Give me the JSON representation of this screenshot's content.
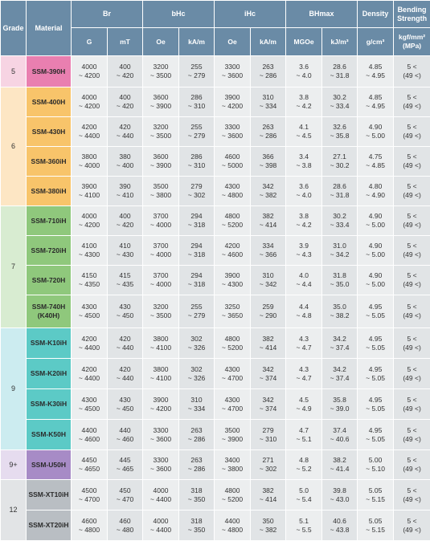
{
  "colors": {
    "header_bg": "#6a8ba6",
    "grade_bg": {
      "5": "#f7d4e3",
      "6": "#fde6c4",
      "7": "#d8ecd1",
      "9": "#ccecf0",
      "9+": "#e6dcef",
      "12": "#e2e4e6"
    },
    "material_bg": {
      "5": "#e97fb0",
      "6": "#f8c46a",
      "7": "#8fc87c",
      "9": "#5ccac6",
      "9+": "#a78bc6",
      "12": "#b9bec3"
    }
  },
  "header": {
    "grade": "Grade",
    "material": "Material",
    "br": "Br",
    "bhc": "bHc",
    "ihc": "iHc",
    "bhmax": "BHmax",
    "density": "Density",
    "bending": "Bending Strength",
    "units": {
      "br_g": "G",
      "br_mt": "mT",
      "bhc_oe": "Oe",
      "bhc_ka": "kA/m",
      "ihc_oe": "Oe",
      "ihc_ka": "kA/m",
      "bh_mgoe": "MGOe",
      "bh_kj": "kJ/m³",
      "density": "g/cm³",
      "bending": "kgf/mm²\n(MPa)"
    }
  },
  "rows": [
    {
      "grade": "5",
      "material": "SSM-390H",
      "br_g": "4000\n~ 4200",
      "br_mt": "400\n~ 420",
      "bhc_oe": "3200\n~ 3500",
      "bhc_ka": "255\n~ 279",
      "ihc_oe": "3300\n~ 3600",
      "ihc_ka": "263\n~ 286",
      "bh_mgoe": "3.6\n~ 4.0",
      "bh_kj": "28.6\n~ 31.8",
      "density": "4.85\n~ 4.95",
      "bending": "5 <\n(49 <)"
    },
    {
      "grade": "6",
      "material": "SSM-400H",
      "br_g": "4000\n~ 4200",
      "br_mt": "400\n~ 420",
      "bhc_oe": "3600\n~ 3900",
      "bhc_ka": "286\n~ 310",
      "ihc_oe": "3900\n~ 4200",
      "ihc_ka": "310\n~ 334",
      "bh_mgoe": "3.8\n~ 4.2",
      "bh_kj": "30.2\n~ 33.4",
      "density": "4.85\n~ 4.95",
      "bending": "5 <\n(49 <)"
    },
    {
      "grade": "6",
      "material": "SSM-430H",
      "br_g": "4200\n~ 4400",
      "br_mt": "420\n~ 440",
      "bhc_oe": "3200\n~ 3500",
      "bhc_ka": "255\n~ 279",
      "ihc_oe": "3300\n~ 3600",
      "ihc_ka": "263\n~ 286",
      "bh_mgoe": "4.1\n~ 4.5",
      "bh_kj": "32.6\n~ 35.8",
      "density": "4.90\n~ 5.00",
      "bending": "5 <\n(49 <)"
    },
    {
      "grade": "6",
      "material": "SSM-360iH",
      "br_g": "3800\n~ 4000",
      "br_mt": "380\n~ 400",
      "bhc_oe": "3600\n~ 3900",
      "bhc_ka": "286\n~ 310",
      "ihc_oe": "4600\n~ 5000",
      "ihc_ka": "366\n~ 398",
      "bh_mgoe": "3.4\n~ 3.8",
      "bh_kj": "27.1\n~ 30.2",
      "density": "4.75\n~ 4.85",
      "bending": "5 <\n(49 <)"
    },
    {
      "grade": "6",
      "material": "SSM-380iH",
      "br_g": "3900\n~ 4100",
      "br_mt": "390\n~ 410",
      "bhc_oe": "3500\n~ 3800",
      "bhc_ka": "279\n~ 302",
      "ihc_oe": "4300\n~ 4800",
      "ihc_ka": "342\n~ 382",
      "bh_mgoe": "3.6\n~ 4.0",
      "bh_kj": "28.6\n~ 31.8",
      "density": "4.80\n~ 4.90",
      "bending": "5 <\n(49 <)"
    },
    {
      "grade": "7",
      "material": "SSM-710iH",
      "br_g": "4000\n~ 4200",
      "br_mt": "400\n~ 420",
      "bhc_oe": "3700\n~ 4000",
      "bhc_ka": "294\n~ 318",
      "ihc_oe": "4800\n~ 5200",
      "ihc_ka": "382\n~ 414",
      "bh_mgoe": "3.8\n~ 4.2",
      "bh_kj": "30.2\n~ 33.4",
      "density": "4.90\n~ 5.00",
      "bending": "5 <\n(49 <)"
    },
    {
      "grade": "7",
      "material": "SSM-720iH",
      "br_g": "4100\n~ 4300",
      "br_mt": "410\n~ 430",
      "bhc_oe": "3700\n~ 4000",
      "bhc_ka": "294\n~ 318",
      "ihc_oe": "4200\n~ 4600",
      "ihc_ka": "334\n~ 366",
      "bh_mgoe": "3.9\n~ 4.3",
      "bh_kj": "31.0\n~ 34.2",
      "density": "4.90\n~ 5.00",
      "bending": "5 <\n(49 <)"
    },
    {
      "grade": "7",
      "material": "SSM-720H",
      "br_g": "4150\n~ 4350",
      "br_mt": "415\n~ 435",
      "bhc_oe": "3700\n~ 4000",
      "bhc_ka": "294\n~ 318",
      "ihc_oe": "3900\n~ 4300",
      "ihc_ka": "310\n~ 342",
      "bh_mgoe": "4.0\n~ 4.4",
      "bh_kj": "31.8\n~ 35.0",
      "density": "4.90\n~ 5.00",
      "bending": "5 <\n(49 <)"
    },
    {
      "grade": "7",
      "material": "SSM-740H\n(K40H)",
      "br_g": "4300\n~ 4500",
      "br_mt": "430\n~ 450",
      "bhc_oe": "3200\n~ 3500",
      "bhc_ka": "255\n~ 279",
      "ihc_oe": "3250\n~ 3650",
      "ihc_ka": "259\n~ 290",
      "bh_mgoe": "4.4\n~ 4.8",
      "bh_kj": "35.0\n~ 38.2",
      "density": "4.95\n~ 5.05",
      "bending": "5 <\n(49 <)"
    },
    {
      "grade": "9",
      "material": "SSM-K10iH",
      "br_g": "4200\n~ 4400",
      "br_mt": "420\n~ 440",
      "bhc_oe": "3800\n~ 4100",
      "bhc_ka": "302\n~ 326",
      "ihc_oe": "4800\n~ 5200",
      "ihc_ka": "382\n~ 414",
      "bh_mgoe": "4.3\n~ 4.7",
      "bh_kj": "34.2\n~ 37.4",
      "density": "4.95\n~ 5.05",
      "bending": "5 <\n(49 <)"
    },
    {
      "grade": "9",
      "material": "SSM-K20iH",
      "br_g": "4200\n~ 4400",
      "br_mt": "420\n~ 440",
      "bhc_oe": "3800\n~ 4100",
      "bhc_ka": "302\n~ 326",
      "ihc_oe": "4300\n~ 4700",
      "ihc_ka": "342\n~ 374",
      "bh_mgoe": "4.3\n~ 4.7",
      "bh_kj": "34.2\n~ 37.4",
      "density": "4.95\n~ 5.05",
      "bending": "5 <\n(49 <)"
    },
    {
      "grade": "9",
      "material": "SSM-K30iH",
      "br_g": "4300\n~ 4500",
      "br_mt": "430\n~ 450",
      "bhc_oe": "3900\n~ 4200",
      "bhc_ka": "310\n~ 334",
      "ihc_oe": "4300\n~ 4700",
      "ihc_ka": "342\n~ 374",
      "bh_mgoe": "4.5\n~ 4.9",
      "bh_kj": "35.8\n~ 39.0",
      "density": "4.95\n~ 5.05",
      "bending": "5 <\n(49 <)"
    },
    {
      "grade": "9",
      "material": "SSM-K50H",
      "br_g": "4400\n~ 4600",
      "br_mt": "440\n~ 460",
      "bhc_oe": "3300\n~ 3600",
      "bhc_ka": "263\n~ 286",
      "ihc_oe": "3500\n~ 3900",
      "ihc_ka": "279\n~ 310",
      "bh_mgoe": "4.7\n~ 5.1",
      "bh_kj": "37.4\n~ 40.6",
      "density": "4.95\n~ 5.05",
      "bending": "5 <\n(49 <)"
    },
    {
      "grade": "9+",
      "material": "SSM-U50H",
      "br_g": "4450\n~ 4650",
      "br_mt": "445\n~ 465",
      "bhc_oe": "3300\n~ 3600",
      "bhc_ka": "263\n~ 286",
      "ihc_oe": "3400\n~ 3800",
      "ihc_ka": "271\n~ 302",
      "bh_mgoe": "4.8\n~ 5.2",
      "bh_kj": "38.2\n~ 41.4",
      "density": "5.00\n~ 5.10",
      "bending": "5 <\n(49 <)"
    },
    {
      "grade": "12",
      "material": "SSM-XT10iH",
      "br_g": "4500\n~ 4700",
      "br_mt": "450\n~ 470",
      "bhc_oe": "4000\n~ 4400",
      "bhc_ka": "318\n~ 350",
      "ihc_oe": "4800\n~ 5200",
      "ihc_ka": "382\n~ 414",
      "bh_mgoe": "5.0\n~ 5.4",
      "bh_kj": "39.8\n~ 43.0",
      "density": "5.05\n~ 5.15",
      "bending": "5 <\n(49 <)"
    },
    {
      "grade": "12",
      "material": "SSM-XT20iH",
      "br_g": "4600\n~ 4800",
      "br_mt": "460\n~ 480",
      "bhc_oe": "4000\n~ 4400",
      "bhc_ka": "318\n~ 350",
      "ihc_oe": "4400\n~ 4800",
      "ihc_ka": "350\n~ 382",
      "bh_mgoe": "5.1\n~ 5.5",
      "bh_kj": "40.6\n~ 43.8",
      "density": "5.05\n~ 5.15",
      "bending": "5 <\n(49 <)"
    }
  ]
}
